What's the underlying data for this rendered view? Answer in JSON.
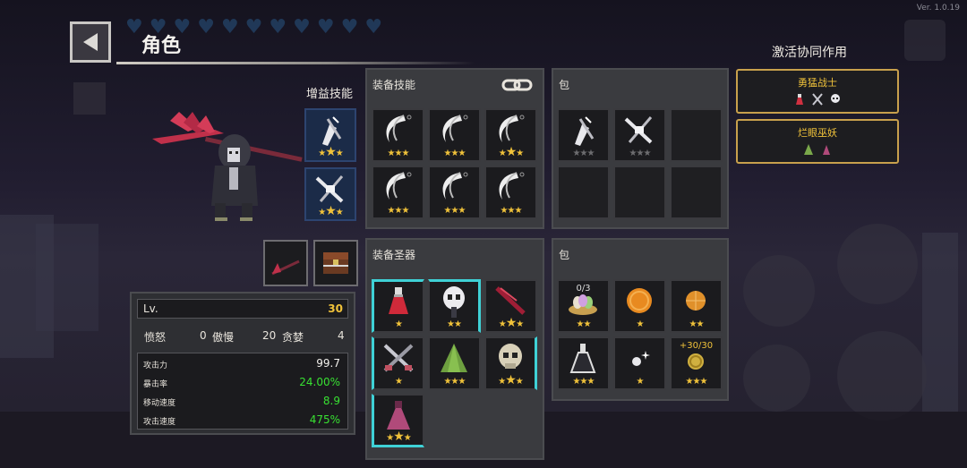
{
  "version": "Ver. 1.0.19",
  "header": {
    "title": "角色",
    "heart_count": 11
  },
  "buff_skills": {
    "label": "增益技能",
    "slots": [
      {
        "icon": "crossbow-up-icon",
        "stars": [
          1,
          2,
          1
        ]
      },
      {
        "icon": "crossbow-x-icon",
        "stars": [
          1,
          2,
          1
        ]
      }
    ]
  },
  "equip_skills": {
    "title": "装备技能",
    "slots": [
      {
        "icon": "moon-slash-icon",
        "stars": [
          1,
          1,
          1
        ]
      },
      {
        "icon": "moon-slash-icon",
        "stars": [
          1,
          1,
          1
        ]
      },
      {
        "icon": "moon-slash-icon",
        "stars": [
          1,
          2,
          1
        ]
      },
      {
        "icon": "moon-slash-icon",
        "stars": [
          1,
          1,
          1
        ]
      },
      {
        "icon": "moon-slash-icon",
        "stars": [
          1,
          1,
          1
        ]
      },
      {
        "icon": "moon-slash-icon",
        "stars": [
          1,
          1,
          1
        ]
      }
    ]
  },
  "skill_bag": {
    "title": "包",
    "slots": [
      {
        "icon": "crossbow-up-icon",
        "stars": [
          0,
          0,
          0
        ]
      },
      {
        "icon": "crossbow-x-icon",
        "stars": [
          0,
          0,
          0
        ]
      },
      {
        "icon": "",
        "stars": []
      },
      {
        "icon": "",
        "stars": []
      },
      {
        "icon": "",
        "stars": []
      },
      {
        "icon": "",
        "stars": []
      }
    ]
  },
  "relics": {
    "title": "装备圣器",
    "slots": [
      {
        "icon": "red-potion-icon",
        "stars": [
          1
        ]
      },
      {
        "icon": "skull-mask-icon",
        "stars": [
          1,
          1
        ]
      },
      {
        "icon": "blood-blade-icon",
        "stars": [
          1,
          2,
          1
        ]
      },
      {
        "icon": "crossed-swords-icon",
        "stars": [
          1
        ]
      },
      {
        "icon": "green-cloak-icon",
        "stars": [
          1,
          1,
          1
        ]
      },
      {
        "icon": "skull-head-icon",
        "stars": [
          1,
          2,
          1
        ]
      },
      {
        "icon": "pink-robe-icon",
        "stars": [
          1,
          2,
          1
        ]
      }
    ]
  },
  "relic_bag": {
    "title": "包",
    "slots": [
      {
        "icon": "egg-nest-icon",
        "counter": "0/3",
        "stars": [
          1,
          1
        ]
      },
      {
        "icon": "orange-coin-icon",
        "counter": "",
        "stars": [
          1
        ]
      },
      {
        "icon": "pizza-coin-icon",
        "counter": "",
        "stars": [
          1,
          1
        ]
      },
      {
        "icon": "flask-icon",
        "counter": "",
        "stars": [
          1,
          1,
          1
        ]
      },
      {
        "icon": "sparkle-orb-icon",
        "counter": "",
        "stars": [
          1
        ]
      },
      {
        "icon": "gold-coin-icon",
        "counter": "+30/30",
        "stars": [
          1,
          1,
          1
        ]
      }
    ]
  },
  "stats": {
    "level_label": "Lv.",
    "level": "30",
    "traits": [
      {
        "name": "愤怒",
        "value": "0"
      },
      {
        "name": "傲慢",
        "value": "20"
      },
      {
        "name": "贪婪",
        "value": "4"
      }
    ],
    "attributes": [
      {
        "name": "攻击力",
        "value": "99.7",
        "color": "#f2f0ec"
      },
      {
        "name": "暴击率",
        "value": "24.00%",
        "color": "#38e032"
      },
      {
        "name": "移动速度",
        "value": "8.9",
        "color": "#38e032"
      },
      {
        "name": "攻击速度",
        "value": "475%",
        "color": "#38e032"
      }
    ]
  },
  "synergy": {
    "title": "激活协同作用",
    "items": [
      {
        "name": "勇猛战士",
        "icons": [
          "potion-icon",
          "swords-icon",
          "skull-icon"
        ]
      },
      {
        "name": "烂眼巫妖",
        "icons": [
          "cloak-icon",
          "robe-icon"
        ]
      }
    ]
  },
  "colors": {
    "star": "#f0c23a",
    "cyan_border": "#3fd1d6",
    "green_stat": "#38e032",
    "gold_border": "#c8a04c"
  }
}
